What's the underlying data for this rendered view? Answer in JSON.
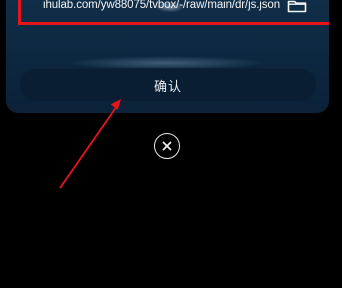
{
  "dialog": {
    "source_url": "ihulab.com/yw88075/tvbox/-/raw/main/dr/js.json",
    "folder_icon": "folder-icon",
    "confirm_label": "确认",
    "close_icon": "close-icon"
  },
  "annotation": {
    "highlight_color": "#e8141c",
    "arrow_color": "#e8141c"
  }
}
